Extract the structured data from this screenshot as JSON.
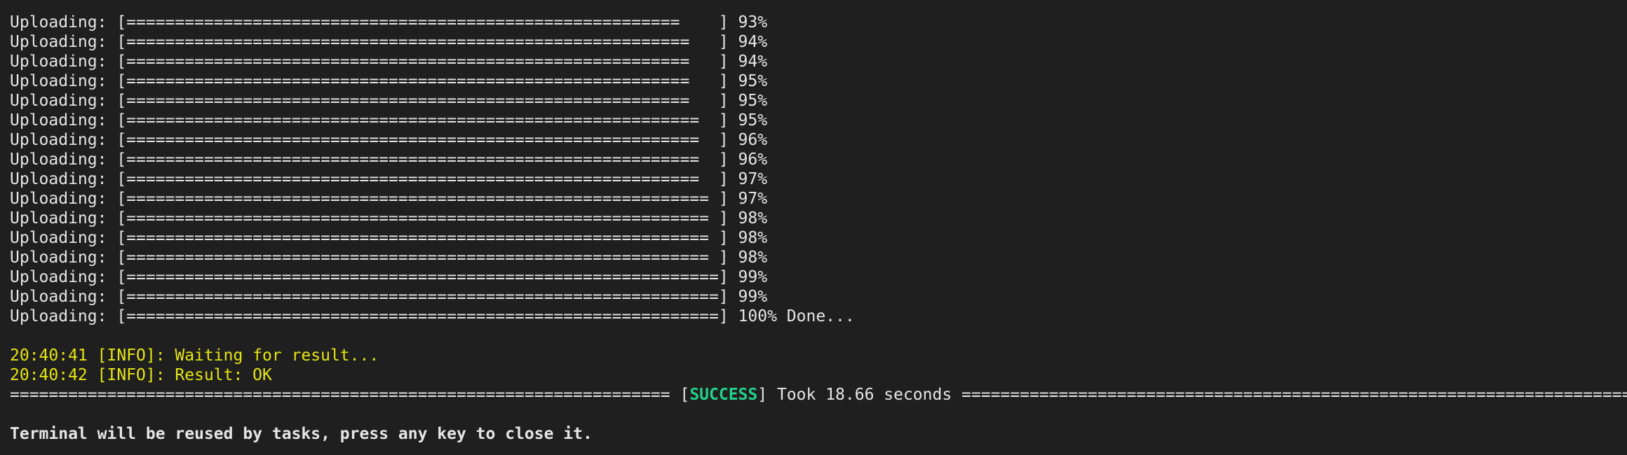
{
  "terminal": {
    "upload_lines": [
      "Uploading: [=========================================================    ] 93%",
      "Uploading: [==========================================================   ] 94%",
      "Uploading: [==========================================================   ] 94%",
      "Uploading: [==========================================================   ] 95%",
      "Uploading: [==========================================================   ] 95%",
      "Uploading: [===========================================================  ] 95%",
      "Uploading: [===========================================================  ] 96%",
      "Uploading: [===========================================================  ] 96%",
      "Uploading: [===========================================================  ] 97%",
      "Uploading: [============================================================ ] 97%",
      "Uploading: [============================================================ ] 98%",
      "Uploading: [============================================================ ] 98%",
      "Uploading: [============================================================ ] 98%",
      "Uploading: [=============================================================] 99%",
      "Uploading: [=============================================================] 99%",
      "Uploading: [=============================================================] 100% Done..."
    ],
    "info_lines": [
      "20:40:41 [INFO]: Waiting for result...",
      "20:40:42 [INFO]: Result: OK"
    ],
    "summary": {
      "left_rule": "==================================================================== [",
      "status": "SUCCESS",
      "middle": "] Took 18.66 seconds ",
      "right_rule": "================================================================================================================================================"
    },
    "footer": "Terminal will be reused by tasks, press any key to close it."
  }
}
